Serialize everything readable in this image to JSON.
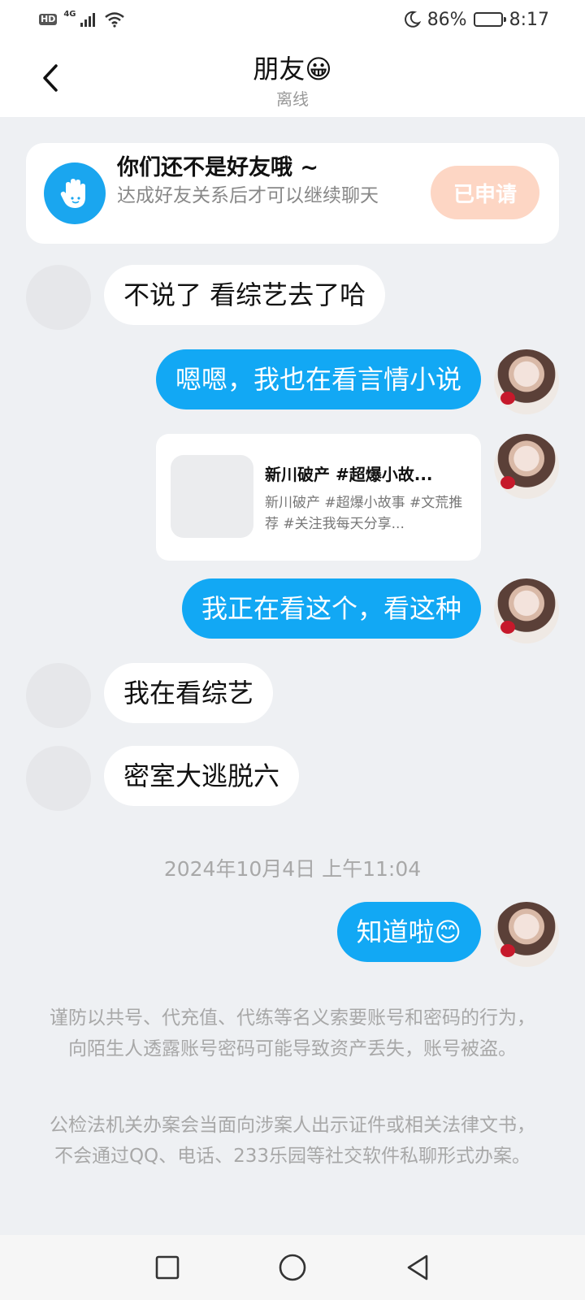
{
  "status_bar": {
    "left_badge": "HD",
    "network_type": "4G",
    "battery_percent": "86%",
    "battery_level": 0.86,
    "time": "8:17"
  },
  "header": {
    "title": "朋友😀",
    "status": "离线"
  },
  "notice": {
    "title": "你们还不是好友哦 ~",
    "description": "达成好友关系后才可以继续聊天",
    "button": "已申请",
    "icon": "waving-hand-icon",
    "accent": "#1aa6ef"
  },
  "messages": [
    {
      "side": "in",
      "text": "不说了 看综艺去了哈"
    },
    {
      "side": "out",
      "text": "嗯嗯，我也在看言情小说"
    },
    {
      "side": "out",
      "type": "share_card",
      "title": "新川破产 #超爆小故...",
      "desc": "新川破产 #超爆小故事 #文荒推荐 #关注我每天分享..."
    },
    {
      "side": "out",
      "text": "我正在看这个，看这种"
    },
    {
      "side": "in",
      "text": "我在看综艺"
    },
    {
      "side": "in",
      "text": "密室大逃脱六"
    },
    {
      "side": "out",
      "text": "知道啦😊"
    }
  ],
  "timestamp": "2024年10月4日 上午11:04",
  "warnings": [
    "谨防以共号、代充值、代练等名义索要账号和密码的行为，向陌生人透露账号密码可能导致资产丢失，账号被盗。",
    "公检法机关办案会当面向涉案人出示证件或相关法律文书，不会通过QQ、电话、233乐园等社交软件私聊形式办案。"
  ],
  "colors": {
    "outgoing_bubble": "#12a8f4",
    "incoming_bubble": "#ffffff",
    "applied_button": "#fdd6c4"
  }
}
